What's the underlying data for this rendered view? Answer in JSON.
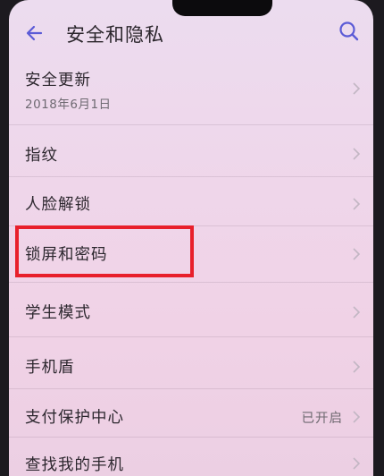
{
  "header": {
    "title": "安全和隐私",
    "back_icon": "back-arrow-icon",
    "search_icon": "search-icon"
  },
  "colors": {
    "accent": "#5b5bd6",
    "highlight": "#e8202b"
  },
  "items": [
    {
      "label": "安全更新",
      "sub": "2018年6月1日"
    },
    {
      "label": "指纹"
    },
    {
      "label": "人脸解锁"
    },
    {
      "label": "锁屏和密码"
    },
    {
      "label": "学生模式"
    },
    {
      "label": "手机盾"
    },
    {
      "label": "支付保护中心",
      "status": "已开启"
    },
    {
      "label": "查找我的手机"
    }
  ]
}
